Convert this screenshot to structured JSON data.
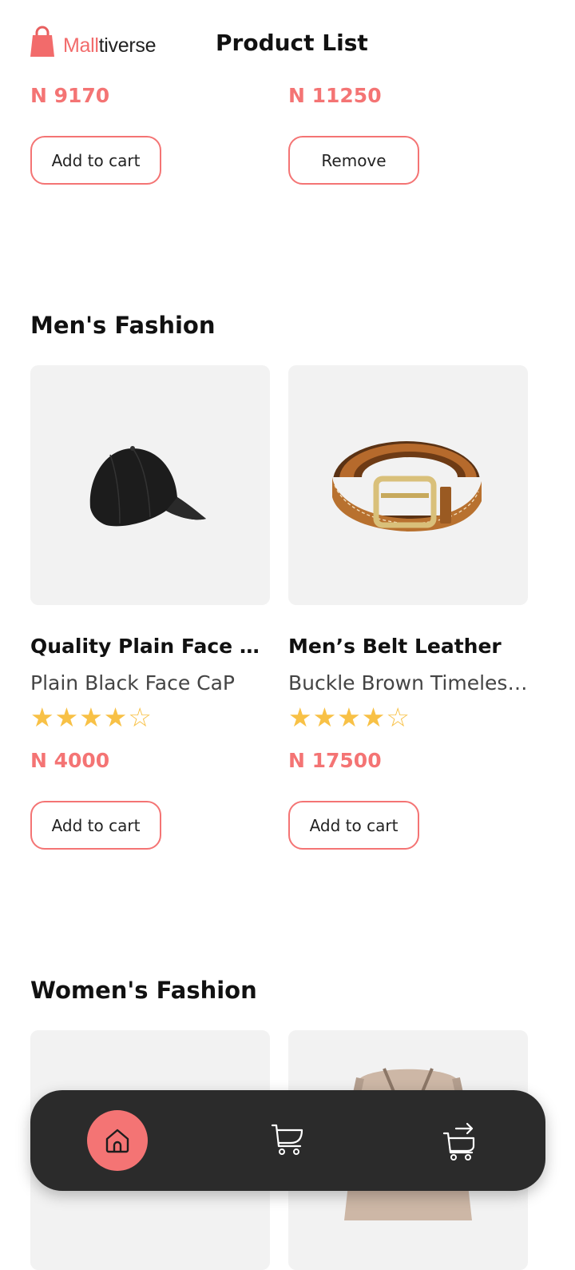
{
  "header": {
    "logo_part1": "Mall",
    "logo_part2": "tiverse",
    "title": "Product List"
  },
  "top_row": {
    "left_price": "N 9170",
    "left_button": "Add to cart",
    "right_price": "N 11250",
    "right_button": "Remove"
  },
  "sections": [
    {
      "title": "Men's Fashion",
      "products": [
        {
          "name": "Quality Plain Face Cap",
          "description": "Plain Black Face CaP",
          "rating": 4,
          "stars": "★★★★☆",
          "price": "N 4000",
          "button": "Add to cart",
          "image": "black-cap"
        },
        {
          "name": "Men’s Belt Leather",
          "description": "Buckle Brown Timeless Belt",
          "rating": 4,
          "stars": "★★★★☆",
          "price": "N 17500",
          "button": "Add to cart",
          "image": "brown-leather-belt"
        }
      ]
    },
    {
      "title": "Women's Fashion",
      "products": [
        {
          "image": "product-image"
        },
        {
          "image": "knit-cardigan"
        }
      ]
    }
  ],
  "nav": {
    "items": [
      {
        "icon": "home-icon",
        "active": true
      },
      {
        "icon": "cart-icon",
        "active": false
      },
      {
        "icon": "checkout-cart-icon",
        "active": false
      }
    ]
  },
  "colors": {
    "accent": "#f47474",
    "star": "#f8c146",
    "nav_bg": "#2b2b2b",
    "card_bg": "#f2f2f2"
  }
}
